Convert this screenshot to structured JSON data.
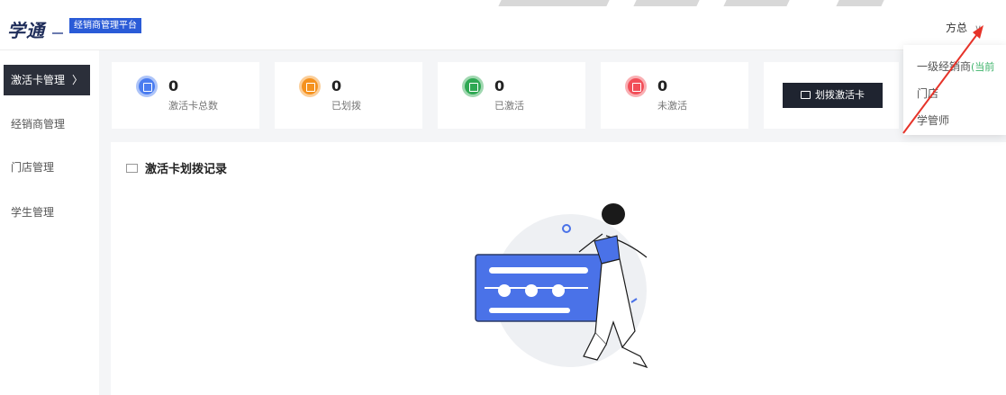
{
  "header": {
    "logo": "学通",
    "platform_badge": "经销商管理平台",
    "user": {
      "name": "方总",
      "chevron": "∨"
    }
  },
  "sidebar": {
    "items": [
      {
        "label": "激活卡管理",
        "arrow": "〉",
        "active": true
      },
      {
        "label": "经销商管理"
      },
      {
        "label": "门店管理"
      },
      {
        "label": "学生管理"
      }
    ]
  },
  "stats": [
    {
      "value": "0",
      "label": "激活卡总数",
      "icon": "card-icon",
      "color": "#4a7cf0"
    },
    {
      "value": "0",
      "label": "已划拨",
      "icon": "card-icon",
      "color": "#f5921e"
    },
    {
      "value": "0",
      "label": "已激活",
      "icon": "check-card-icon",
      "color": "#2fa853"
    },
    {
      "value": "0",
      "label": "未激活",
      "icon": "card-icon",
      "color": "#f24e58"
    }
  ],
  "actions": {
    "allocate_label": "划拨激活卡"
  },
  "records": {
    "title": "激活卡划拨记录"
  },
  "dropdown": {
    "items": [
      {
        "label": "一级经销商",
        "suffix": "(当前"
      },
      {
        "label": "门店"
      },
      {
        "label": "学管师"
      }
    ]
  },
  "colors": {
    "accent": "#2a5bd7",
    "dark": "#2b2f3a",
    "annotation": "#e63329"
  }
}
